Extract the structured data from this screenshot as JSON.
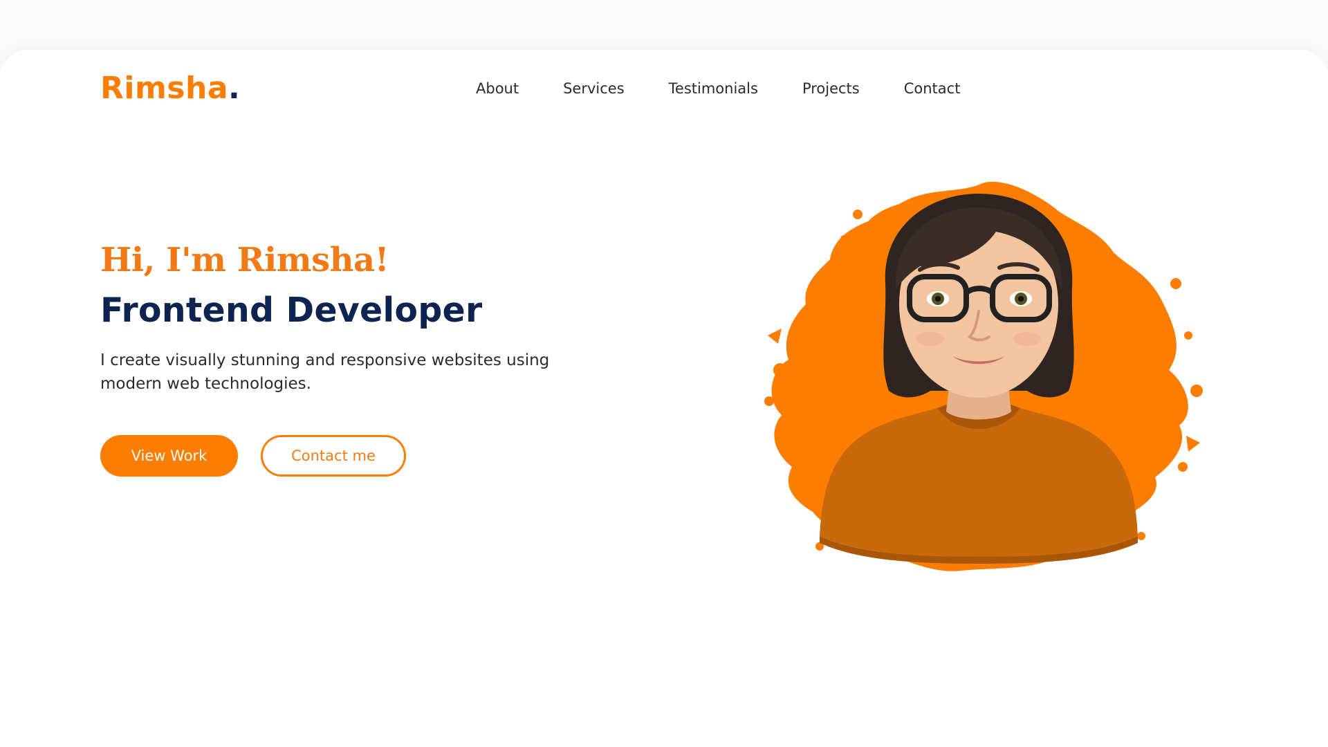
{
  "brand": {
    "name": "Rimsha",
    "dot": "."
  },
  "nav": {
    "items": [
      {
        "label": "About"
      },
      {
        "label": "Services"
      },
      {
        "label": "Testimonials"
      },
      {
        "label": "Projects"
      },
      {
        "label": "Contact"
      }
    ]
  },
  "hero": {
    "greeting": "Hi, I'm Rimsha!",
    "role": "Frontend Developer",
    "description": "I create visually stunning and responsive websites using modern web technologies.",
    "buttons": {
      "primary_label": "View Work",
      "secondary_label": "Contact me"
    },
    "avatar_icon": "avatar-illustration"
  },
  "colors": {
    "accent": "#fb7d02",
    "heading_dark": "#0d2350",
    "text": "#2b2b2b",
    "background": "#ffffff"
  }
}
